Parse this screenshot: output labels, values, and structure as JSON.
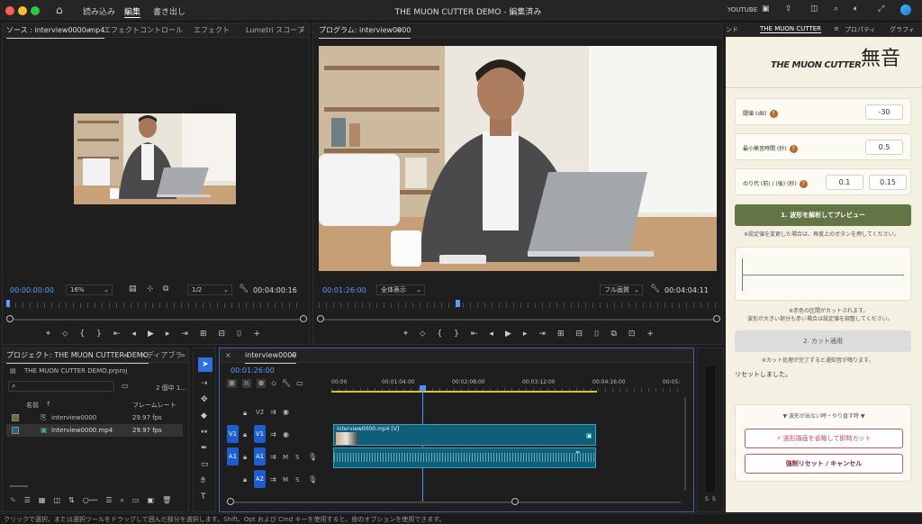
{
  "app": {
    "title": "THE MUON CUTTER DEMO - 編集済み",
    "menu": [
      "読み込み",
      "編集",
      "書き出し"
    ],
    "active_menu": "編集",
    "workspace": "YOUTUBE"
  },
  "source": {
    "tabs": [
      "ソース : interview0000.mp4",
      "エフェクトコントロール",
      "エフェクト",
      "Lumetri スコープ"
    ],
    "timecode": "00:00:00:00",
    "zoom": "16%",
    "quality": "1/2",
    "duration": "00:04:00:16"
  },
  "program": {
    "title": "プログラム: interview0000",
    "timecode": "00:01:26:00",
    "fit": "全体表示",
    "quality": "フル画質",
    "duration": "00:04:04:11"
  },
  "project": {
    "tabs": [
      "プロジェクト: THE MUON CUTTER DEMO",
      "メディアブラ"
    ],
    "file": "THE MUON CUTTER DEMO.prproj",
    "count": "2 個中 1...",
    "col_name": "名前",
    "col_fps": "フレームレート",
    "items": [
      {
        "name": "interview0000",
        "fps": "29.97 fps"
      },
      {
        "name": "interview0000.mp4",
        "fps": "29.97 fps"
      }
    ]
  },
  "timeline": {
    "tab": "interview0000",
    "timecode": "00:01:26:00",
    "ruler": [
      "00:00",
      "00:01:04:00",
      "00:02:08:00",
      "00:03:12:00",
      "00:04:16:00",
      "00:05:"
    ],
    "tracks": [
      "V2",
      "V1",
      "A1",
      "A2"
    ],
    "clip": "interview0000.mp4 [V]",
    "level_labels": [
      "S",
      "S"
    ]
  },
  "right": {
    "tabs": [
      "ンド",
      "THE MUON CUTTER",
      "プロパティ",
      "グラフィ"
    ],
    "logo_small": "THE MUON CUTTER",
    "logo_kanji": "無音",
    "params": [
      {
        "label": "閾値 (dB)",
        "value": "-30"
      },
      {
        "label": "最小無音時間 (秒)",
        "value": "0.5"
      },
      {
        "label": "のり代 (前) / (後) (秒)",
        "value1": "0.1",
        "value2": "0.15"
      }
    ],
    "analyze_btn": "1. 波形を解析してプレビュー",
    "analyze_note": "※設定値を変更した場合は、再度上のボタンを押してください。",
    "wave_note1": "※赤色の区間がカットされます。",
    "wave_note2": "波形が大きい部分も赤い場合は設定値を調整してください。",
    "cut_btn": "2. カット適用",
    "cut_note": "※カット処理が完了すると通知音が鳴ります。",
    "reset_msg": "リセットしました。",
    "trouble": "▼ 波形が出ない時・やり直す時 ▼",
    "skip_btn": "⚡ 波形描画を省略して即時カット",
    "reset_btn": "強制リセット / キャンセル"
  },
  "status": "クリックで選択、または選択ツールをドラッグして囲んだ部分を選択します。Shift、Opt および Cmd キーを使用すると、他のオプションを使用できます。",
  "colors": {
    "accent": "#5b9bff",
    "track": "#1c5ed1",
    "clip": "#0f5f78",
    "analyze": "#637545"
  }
}
